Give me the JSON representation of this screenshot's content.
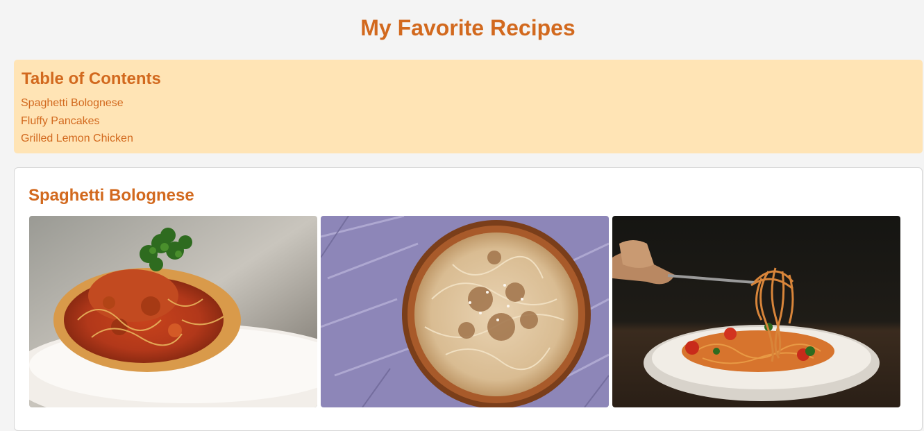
{
  "header": {
    "title": "My Favorite Recipes"
  },
  "toc": {
    "heading": "Table of Contents",
    "items": [
      "Spaghetti Bolognese",
      "Fluffy Pancakes",
      "Grilled Lemon Chicken"
    ]
  },
  "recipes": [
    {
      "title": "Spaghetti Bolognese",
      "photos": [
        "spaghetti-on-white-plate-photo",
        "spaghetti-in-wooden-bowl-photo",
        "fork-twirling-spaghetti-photo"
      ]
    }
  ],
  "colors": {
    "accent": "#d2691e",
    "toc_background": "#ffe4b5",
    "page_background": "#f4f4f4",
    "card_background": "#ffffff"
  }
}
